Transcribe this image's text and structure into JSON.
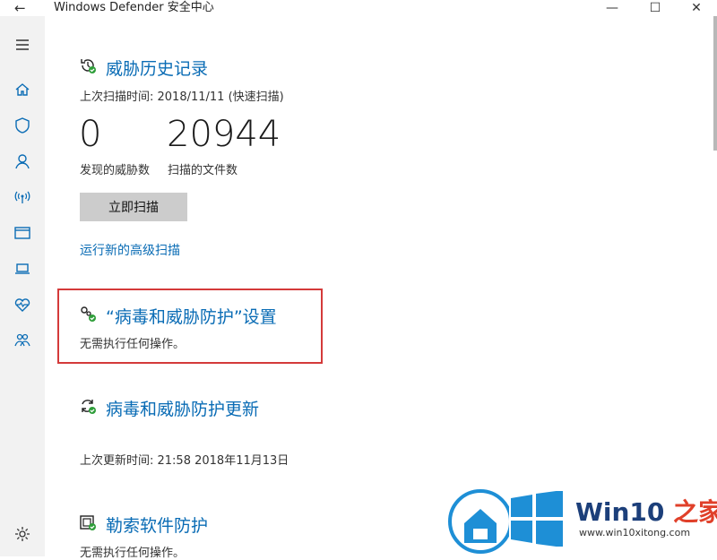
{
  "window": {
    "title": "Windows Defender 安全中心",
    "back": "←",
    "min": "—",
    "max": "☐",
    "close": "✕"
  },
  "sidebar": {
    "items": [
      {
        "name": "menu-icon"
      },
      {
        "name": "home-icon"
      },
      {
        "name": "shield-icon"
      },
      {
        "name": "account-icon"
      },
      {
        "name": "network-icon"
      },
      {
        "name": "app-browser-icon"
      },
      {
        "name": "device-icon"
      },
      {
        "name": "health-icon"
      },
      {
        "name": "family-icon"
      },
      {
        "name": "settings-icon"
      }
    ]
  },
  "history": {
    "title": "威胁历史记录",
    "last_scan": "上次扫描时间: 2018/11/11 (快速扫描)",
    "threats_count": "0",
    "threats_label": "发现的威胁数",
    "files_count": "20944",
    "files_label": "扫描的文件数",
    "scan_button": "立即扫描",
    "advanced_link": "运行新的高级扫描"
  },
  "settings": {
    "title": "“病毒和威胁防护”设置",
    "status": "无需执行任何操作。"
  },
  "updates": {
    "title": "病毒和威胁防护更新",
    "last_update": "上次更新时间: 21:58 2018年11月13日"
  },
  "ransomware": {
    "title": "勒索软件防护",
    "status": "无需执行任何操作。"
  },
  "watermark": {
    "brand": "Win10",
    "brand_suffix": "之家",
    "url": "www.win10xitong.com"
  },
  "colors": {
    "accent": "#0a6cb5",
    "highlight": "#d43a3a",
    "ok": "#2f9e3a"
  }
}
